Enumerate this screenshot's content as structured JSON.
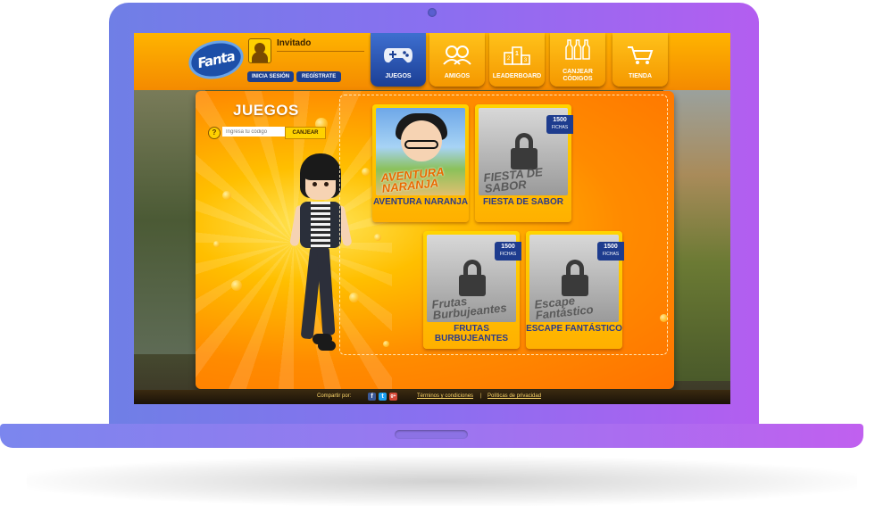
{
  "header": {
    "brand_logo": "Fanta",
    "user_name": "Invitado",
    "login_label": "INICIA SESIÓN",
    "register_label": "REGÍSTRATE"
  },
  "nav": {
    "tabs": [
      {
        "label": "JUEGOS",
        "icon": "gamepad-icon",
        "active": true
      },
      {
        "label": "AMIGOS",
        "icon": "friends-icon",
        "active": false
      },
      {
        "label": "LEADERBOARD",
        "icon": "podium-icon",
        "active": false
      },
      {
        "label": "CANJEAR\nCÓDIGOS",
        "icon": "bottles-icon",
        "active": false
      },
      {
        "label": "TIENDA",
        "icon": "cart-icon",
        "active": false
      }
    ]
  },
  "panel": {
    "title": "JUEGOS",
    "help_label": "?",
    "code_placeholder": "Ingresa tu código",
    "redeem_label": "CANJEAR"
  },
  "games": [
    {
      "title": "AVENTURA NARANJA",
      "thumb_text": "AVENTURA NARANJA",
      "locked": false
    },
    {
      "title": "FIESTA DE SABOR",
      "thumb_text": "FIESTA DE SABOR",
      "locked": true,
      "cost": "1500",
      "cost_unit": "FICHAS"
    },
    {
      "title": "FRUTAS BURBUJEANTES",
      "thumb_text": "Frutas Burbujeantes",
      "locked": true,
      "cost": "1500",
      "cost_unit": "FICHAS"
    },
    {
      "title": "ESCAPE FANTÁSTICO",
      "thumb_text": "Escape Fantástico",
      "locked": true,
      "cost": "1500",
      "cost_unit": "FICHAS"
    }
  ],
  "footer": {
    "share_label": "Compartir por:",
    "social": [
      "f",
      "t",
      "g+"
    ],
    "terms_label": "Términos y condiciones",
    "separator": "|",
    "privacy_label": "Políticas de privacidad"
  },
  "colors": {
    "accent_orange": "#ff8b00",
    "nav_active": "#1b3f95",
    "title_blue": "#2b3b8a",
    "laptop_gradient_start": "#6f7fe6",
    "laptop_gradient_end": "#b35ef0"
  }
}
